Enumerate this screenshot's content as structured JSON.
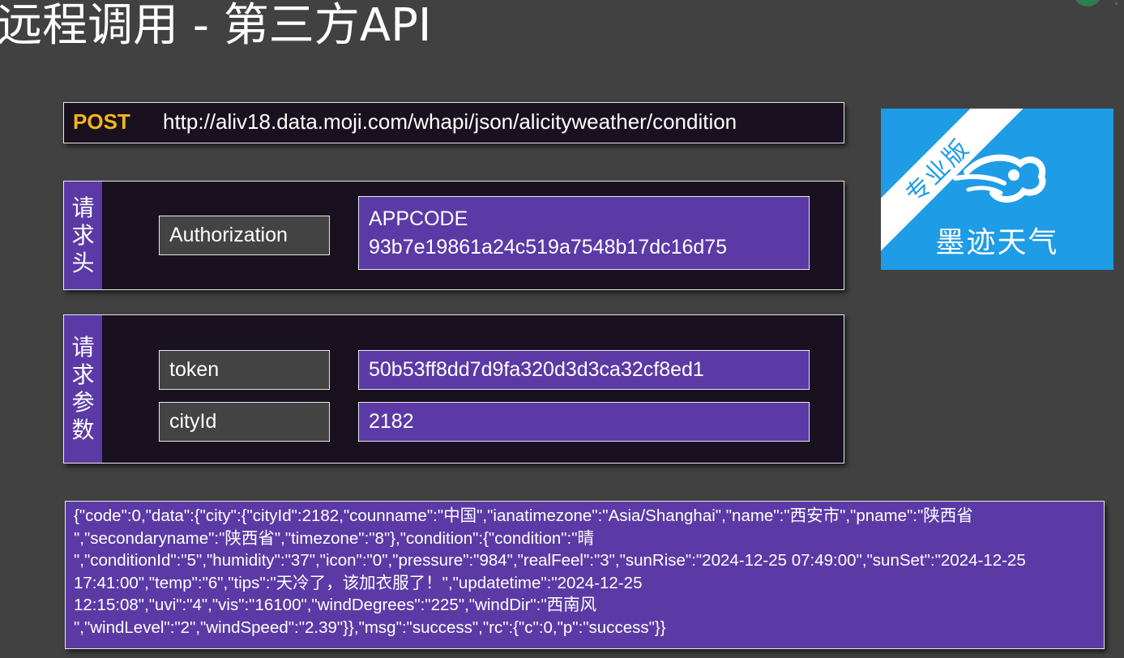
{
  "slide": {
    "title": "远程调用 - 第三方API"
  },
  "request": {
    "method": "POST",
    "url": "http://aliv18.data.moji.com/whapi/json/alicityweather/condition"
  },
  "headers_section": {
    "label_chars": [
      "请",
      "求",
      "头"
    ],
    "key": "Authorization",
    "value_lines": [
      "APPCODE",
      "93b7e19861a24c519a7548b17dc16d75"
    ]
  },
  "params_section": {
    "label_chars": [
      "请",
      "求",
      "参",
      "数"
    ],
    "params": [
      {
        "key": "token",
        "value": "50b53ff8dd7d9fa320d3d3ca32cf8ed1"
      },
      {
        "key": "cityId",
        "value": "2182"
      }
    ]
  },
  "logo": {
    "banner_text": "专业版",
    "name": "墨迹天气",
    "icon": "cloud-wind-icon",
    "colors": {
      "background": "#1e9ce6",
      "banner": "#ffffff"
    }
  },
  "response": {
    "lines": [
      "{\"code\":0,\"data\":{\"city\":{\"cityId\":2182,\"counname\":\"中国\",\"ianatimezone\":\"Asia/Shanghai\",\"name\":\"西安市\",\"pname\":\"陕西省",
      "\",\"secondaryname\":\"陕西省\",\"timezone\":\"8\"},\"condition\":{\"condition\":\"晴",
      "\",\"conditionId\":\"5\",\"humidity\":\"37\",\"icon\":\"0\",\"pressure\":\"984\",\"realFeel\":\"3\",\"sunRise\":\"2024-12-25 07:49:00\",\"sunSet\":\"2024-12-25",
      "17:41:00\",\"temp\":\"6\",\"tips\":\"天冷了，该加衣服了！\",\"updatetime\":\"2024-12-25",
      "12:15:08\",\"uvi\":\"4\",\"vis\":\"16100\",\"windDegrees\":\"225\",\"windDir\":\"西南风",
      "\",\"windLevel\":\"2\",\"windSpeed\":\"2.39\"}},\"msg\":\"success\",\"rc\":{\"c\":0,\"p\":\"success\"}}"
    ]
  },
  "theme": {
    "accent": "#5b3aa6",
    "method_color": "#f7b614",
    "dark_panel": "#1a1120",
    "background": "#414141"
  }
}
